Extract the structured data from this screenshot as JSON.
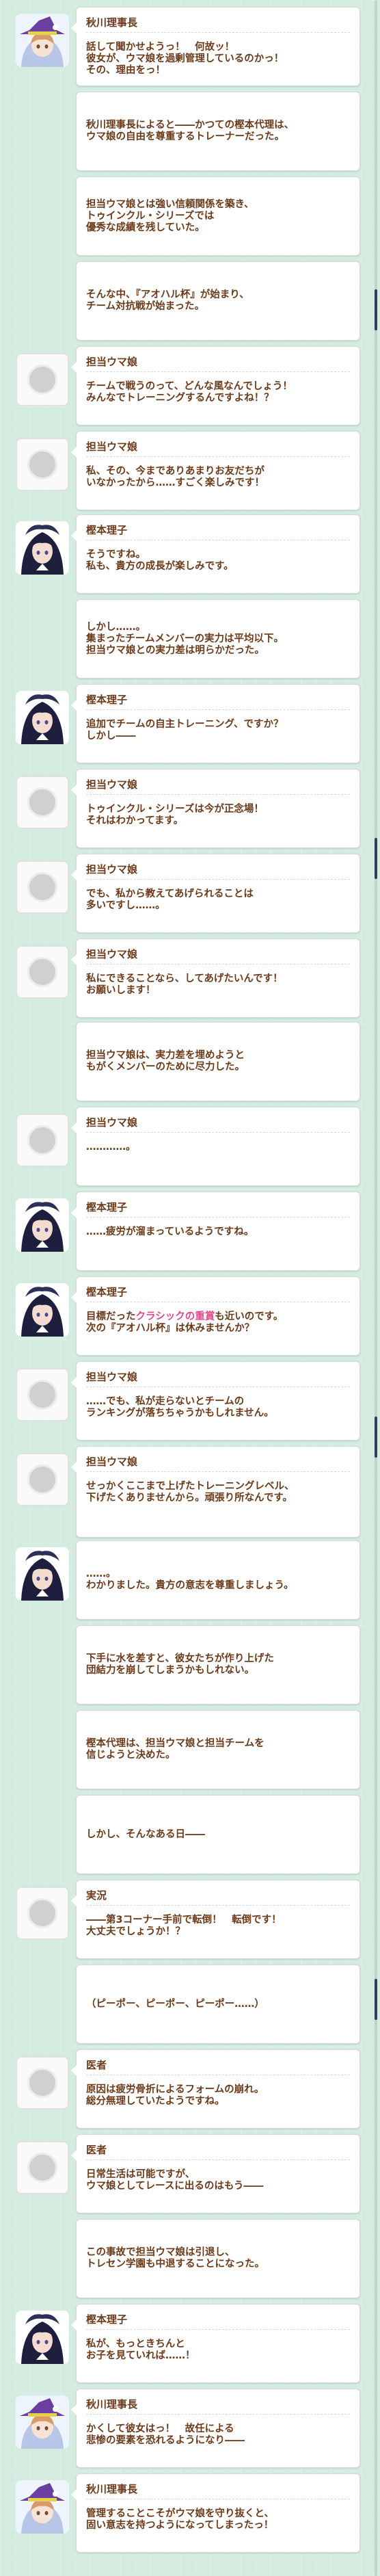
{
  "entries": [
    {
      "speaker": "秋川理事長",
      "avatar": "akikawa-portrait",
      "lines": [
        "話して聞かせようっ！　何故ッ！",
        "彼女が、ウマ娘を過剰管理しているのかっ！",
        "その、理由をっ！"
      ]
    },
    {
      "speaker": "",
      "avatar": "",
      "lines": [
        "秋川理事長によると――かつての樫本代理は、",
        "ウマ娘の自由を尊重するトレーナーだった。"
      ]
    },
    {
      "speaker": "",
      "avatar": "",
      "lines": [
        "担当ウマ娘とは強い信頼関係を築き、",
        "トゥインクル・シリーズでは",
        "優秀な成績を残していた。"
      ]
    },
    {
      "speaker": "",
      "avatar": "",
      "lines": [
        "そんな中、『アオハル杯』が始まり、",
        "チーム対抗戦が始まった。"
      ]
    },
    {
      "speaker": "担当ウマ娘",
      "avatar": "silhouette",
      "lines": [
        "チームで戦うのって、どんな風なんでしょう！",
        "みんなでトレーニングするんですよね！？"
      ]
    },
    {
      "speaker": "担当ウマ娘",
      "avatar": "silhouette",
      "lines": [
        "私、その、今までありあまりお友だちが",
        "いなかったから……すごく楽しみです！"
      ]
    },
    {
      "speaker": "樫本理子",
      "avatar": "kashimoto-portrait",
      "lines": [
        "そうですね。",
        "私も、貴方の成長が楽しみです。"
      ]
    },
    {
      "speaker": "",
      "avatar": "",
      "lines": [
        "しかし……。",
        "集まったチームメンバーの実力は平均以下。",
        "担当ウマ娘との実力差は明らかだった。"
      ]
    },
    {
      "speaker": "樫本理子",
      "avatar": "kashimoto-portrait",
      "lines": [
        "追加でチームの自主トレーニング、ですか？",
        "しかし――"
      ]
    },
    {
      "speaker": "担当ウマ娘",
      "avatar": "silhouette",
      "lines": [
        "トゥインクル・シリーズは今が正念場！",
        "それはわかってます。"
      ]
    },
    {
      "speaker": "担当ウマ娘",
      "avatar": "silhouette",
      "lines": [
        "でも、私から教えてあげられることは",
        "多いですし……。"
      ]
    },
    {
      "speaker": "担当ウマ娘",
      "avatar": "silhouette",
      "lines": [
        "私にできることなら、してあげたいんです！",
        "お願いします！"
      ]
    },
    {
      "speaker": "",
      "avatar": "",
      "lines": [
        "担当ウマ娘は、実力差を埋めようと",
        "もがくメンバーのために尽力した。"
      ]
    },
    {
      "speaker": "担当ウマ娘",
      "avatar": "silhouette",
      "lines": [
        "…………。"
      ]
    },
    {
      "speaker": "樫本理子",
      "avatar": "kashimoto-portrait",
      "lines": [
        "……疲労が溜まっているようですね。"
      ]
    },
    {
      "speaker": "樫本理子",
      "avatar": "kashimoto-portrait",
      "lines": [
        {
          "pre": "目標だった",
          "hl": "クラシックの重賞",
          "post": "も近いのです。"
        },
        "次の『アオハル杯』は休みませんか？"
      ]
    },
    {
      "speaker": "担当ウマ娘",
      "avatar": "silhouette",
      "lines": [
        "……でも、私が走らないとチームの",
        "ランキングが落ちちゃうかもしれません。"
      ]
    },
    {
      "speaker": "担当ウマ娘",
      "avatar": "silhouette",
      "lines": [
        "せっかくここまで上げたトレーニングレベル、",
        "下げたくありませんから。頑張り所なんです。"
      ]
    },
    {
      "speaker": "",
      "avatar": "kashimoto-portrait",
      "lines": [
        "……。",
        "わかりました。貴方の意志を尊重しましょう。"
      ]
    },
    {
      "speaker": "",
      "avatar": "",
      "lines": [
        "下手に水を差すと、彼女たちが作り上げた",
        "団結力を崩してしまうかもしれない。"
      ]
    },
    {
      "speaker": "",
      "avatar": "",
      "lines": [
        "樫本代理は、担当ウマ娘と担当チームを",
        "信じようと決めた。"
      ]
    },
    {
      "speaker": "",
      "avatar": "",
      "lines": [
        "しかし、そんなある日――"
      ]
    },
    {
      "speaker": "実況",
      "avatar": "silhouette",
      "lines": [
        "――第3コーナー手前で転倒！　転倒です！",
        "大丈夫でしょうか！？"
      ]
    },
    {
      "speaker": "",
      "avatar": "",
      "lines": [
        "（ピーポー、ピーポー、ピーポー……）"
      ]
    },
    {
      "speaker": "医者",
      "avatar": "silhouette",
      "lines": [
        "原因は疲労骨折によるフォームの崩れ。",
        "総分無理していたようですね。"
      ]
    },
    {
      "speaker": "医者",
      "avatar": "silhouette",
      "lines": [
        "日常生活は可能ですが、",
        "ウマ娘としてレースに出るのはもう――"
      ]
    },
    {
      "speaker": "",
      "avatar": "",
      "lines": [
        "この事故で担当ウマ娘は引退し、",
        "トレセン学園も中退することになった。"
      ]
    },
    {
      "speaker": "樫本理子",
      "avatar": "kashimoto-portrait",
      "lines": [
        "私が、もっときちんと",
        "お子を見ていれば……！"
      ]
    },
    {
      "speaker": "秋川理事長",
      "avatar": "akikawa-portrait",
      "lines": [
        "かくして彼女はっ！　故任による",
        "悲惨の要素を恐れるようになり――"
      ]
    },
    {
      "speaker": "秋川理事長",
      "avatar": "akikawa-portrait",
      "lines": [
        "管理することこそがウマ娘を守り抜くと、",
        "固い意志を持つようになってしまったっ！"
      ]
    }
  ]
}
